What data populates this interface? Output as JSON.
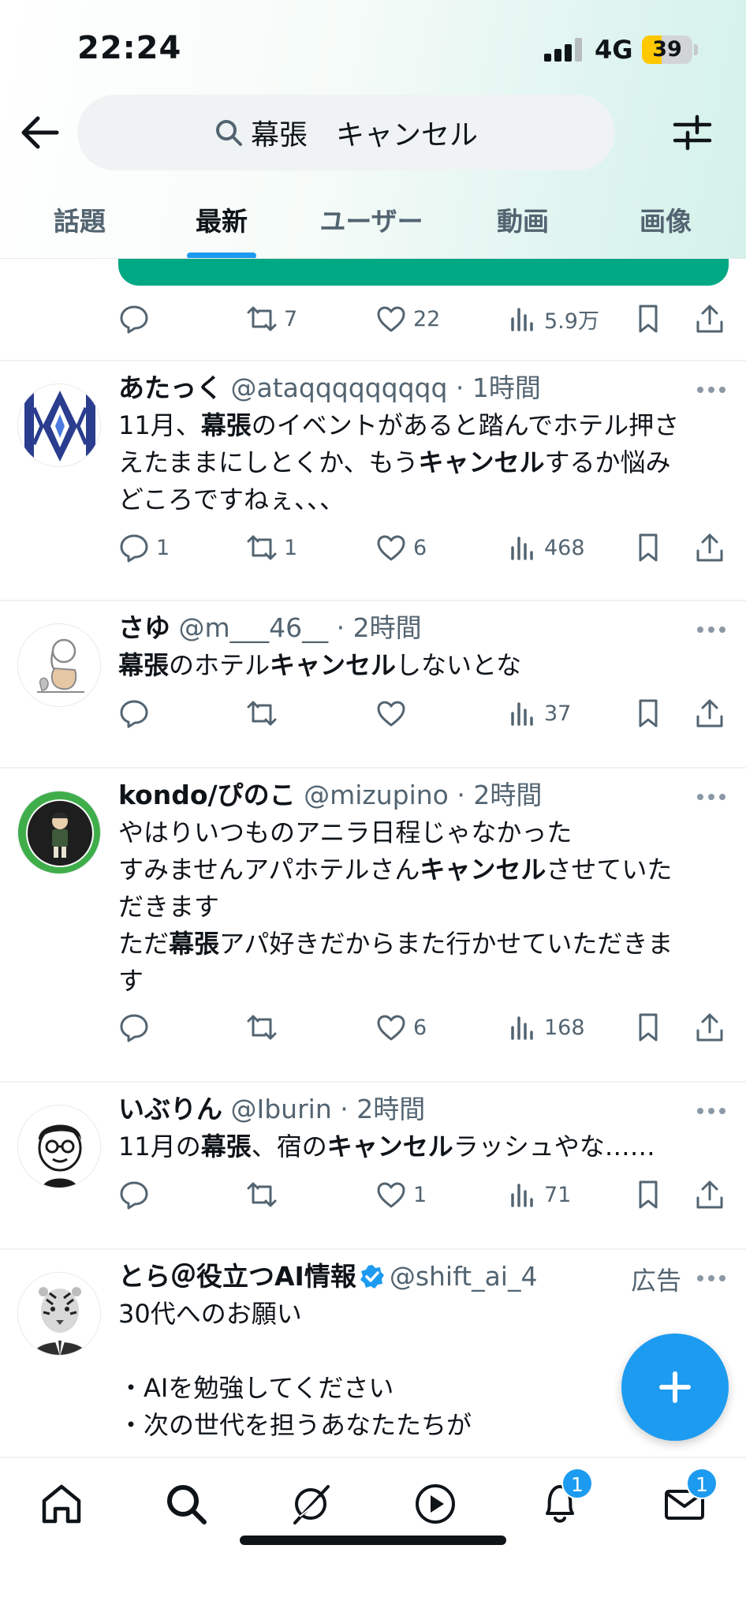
{
  "status_bar": {
    "time": "22:24",
    "network": "4G",
    "battery": "39"
  },
  "search": {
    "query": "幕張　キャンセル"
  },
  "tabs": [
    {
      "label": "話題"
    },
    {
      "label": "最新",
      "active": true
    },
    {
      "label": "ユーザー"
    },
    {
      "label": "動画"
    },
    {
      "label": "画像"
    }
  ],
  "previous_tweet": {
    "retweets": "7",
    "likes": "22",
    "views": "5.9万"
  },
  "tweets": [
    {
      "name": "あたっく",
      "handle": "@ataqqqqqqqqq",
      "time": "1時間",
      "lines": [
        [
          {
            "t": "11月、"
          },
          {
            "t": "幕張",
            "b": true
          },
          {
            "t": "のイベントがあると踏んでホテル押さ"
          }
        ],
        [
          {
            "t": "えたままにしとくか、もう"
          },
          {
            "t": "キャンセル",
            "b": true
          },
          {
            "t": "するか悩み"
          }
        ],
        [
          {
            "t": "どころですねぇ、、、"
          }
        ]
      ],
      "replies": "1",
      "retweets": "1",
      "likes": "6",
      "views": "468"
    },
    {
      "name": "さゆ",
      "handle": "@m___46__",
      "time": "2時間",
      "lines": [
        [
          {
            "t": "幕張",
            "b": true
          },
          {
            "t": "のホテル"
          },
          {
            "t": "キャンセル",
            "b": true
          },
          {
            "t": "しないとな"
          }
        ]
      ],
      "replies": "",
      "retweets": "",
      "likes": "",
      "views": "37"
    },
    {
      "name": "kondo/ぴのこ",
      "handle": "@mizupino",
      "time": "2時間",
      "lines": [
        [
          {
            "t": "やはりいつものアニラ日程じゃなかった"
          }
        ],
        [
          {
            "t": "すみませんアパホテルさん"
          },
          {
            "t": "キャンセル",
            "b": true
          },
          {
            "t": "させていた"
          }
        ],
        [
          {
            "t": "だきます"
          }
        ],
        [
          {
            "t": "ただ"
          },
          {
            "t": "幕張",
            "b": true
          },
          {
            "t": "アパ好きだからまた行かせていただきま"
          }
        ],
        [
          {
            "t": "す"
          }
        ]
      ],
      "replies": "",
      "retweets": "",
      "likes": "6",
      "views": "168"
    },
    {
      "name": "いぶりん",
      "handle": "@Iburin",
      "time": "2時間",
      "lines": [
        [
          {
            "t": "11月の"
          },
          {
            "t": "幕張",
            "b": true
          },
          {
            "t": "、宿の"
          },
          {
            "t": "キャンセル",
            "b": true
          },
          {
            "t": "ラッシュやな……"
          }
        ]
      ],
      "replies": "",
      "retweets": "",
      "likes": "1",
      "views": "71"
    },
    {
      "name": "とら＠役立つAI情報",
      "handle": "@shift_ai_4",
      "ad_label": "広告",
      "lines": [
        [
          {
            "t": "30代へのお願い"
          }
        ],
        [
          {
            "t": ""
          }
        ],
        [
          {
            "t": "・AIを勉強してください"
          }
        ],
        [
          {
            "t": "・次の世代を担うあなたたちが"
          }
        ]
      ]
    }
  ],
  "bottom_nav": {
    "notifications_badge": "1",
    "messages_badge": "1"
  },
  "colors": {
    "accent": "#1d9bf0",
    "text": "#0f1419",
    "secondary": "#536471",
    "promo_green": "#00a884"
  }
}
